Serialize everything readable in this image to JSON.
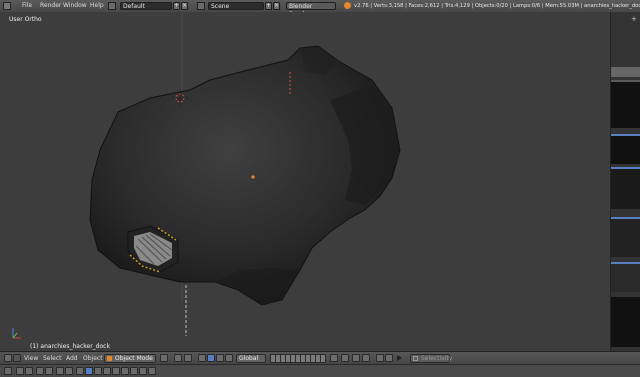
{
  "menu": {
    "file": "File",
    "render": "Render",
    "window": "Window",
    "help": "Help"
  },
  "screen_layout": {
    "value": "Default"
  },
  "scene": {
    "value": "Scene"
  },
  "engine": {
    "value": "Blender Render"
  },
  "stats": {
    "text": "v2.76 | Verts:3,158 | Faces:2,612 | Tris:4,129 | Objects:0/20 | Lamps:0/6 | Mem:55.03M | anarchies_hacker_dock"
  },
  "viewport": {
    "view_label": "User Ortho",
    "object_label": "(1) anarchies_hacker_dock"
  },
  "header": {
    "view": "View",
    "select": "Select",
    "add": "Add",
    "object": "Object",
    "mode": "Object Mode",
    "orientation": "Global",
    "selectivity": "Selectivity"
  },
  "colors": {
    "accent": "#5680c2",
    "active_orange": "#e6892a"
  }
}
